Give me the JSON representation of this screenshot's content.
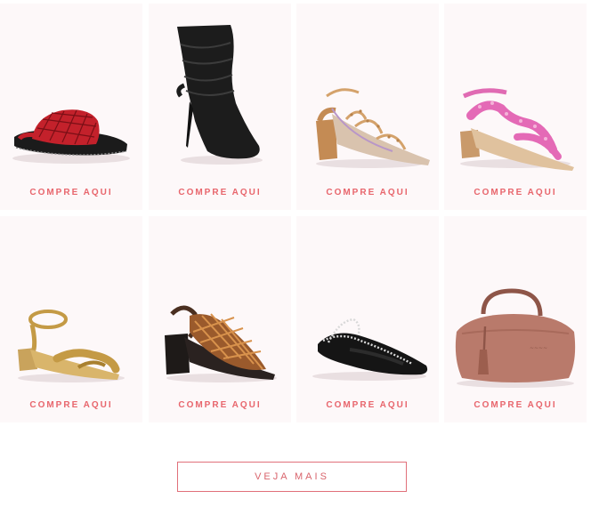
{
  "products": [
    {
      "image": "red-woven-slide-sandal",
      "cta_label": "COMPRE AQUI"
    },
    {
      "image": "black-slouch-boot",
      "cta_label": "COMPRE AQUI"
    },
    {
      "image": "studded-strappy-block-heel-sandal",
      "cta_label": "COMPRE AQUI"
    },
    {
      "image": "pink-scalloped-strap-sandal",
      "cta_label": "COMPRE AQUI"
    },
    {
      "image": "gold-metallic-ankle-strap-sandal",
      "cta_label": "COMPRE AQUI"
    },
    {
      "image": "bronze-woven-block-heel-slingback",
      "cta_label": "COMPRE AQUI"
    },
    {
      "image": "black-studded-pointed-flat",
      "cta_label": "COMPRE AQUI"
    },
    {
      "image": "blush-hobo-handbag-with-tassel",
      "cta_label": "COMPRE AQUI"
    }
  ],
  "more_button": {
    "label": "VEJA MAIS"
  },
  "colors": {
    "accent": "#e8666d",
    "card_bg": "#fdf8f9"
  }
}
